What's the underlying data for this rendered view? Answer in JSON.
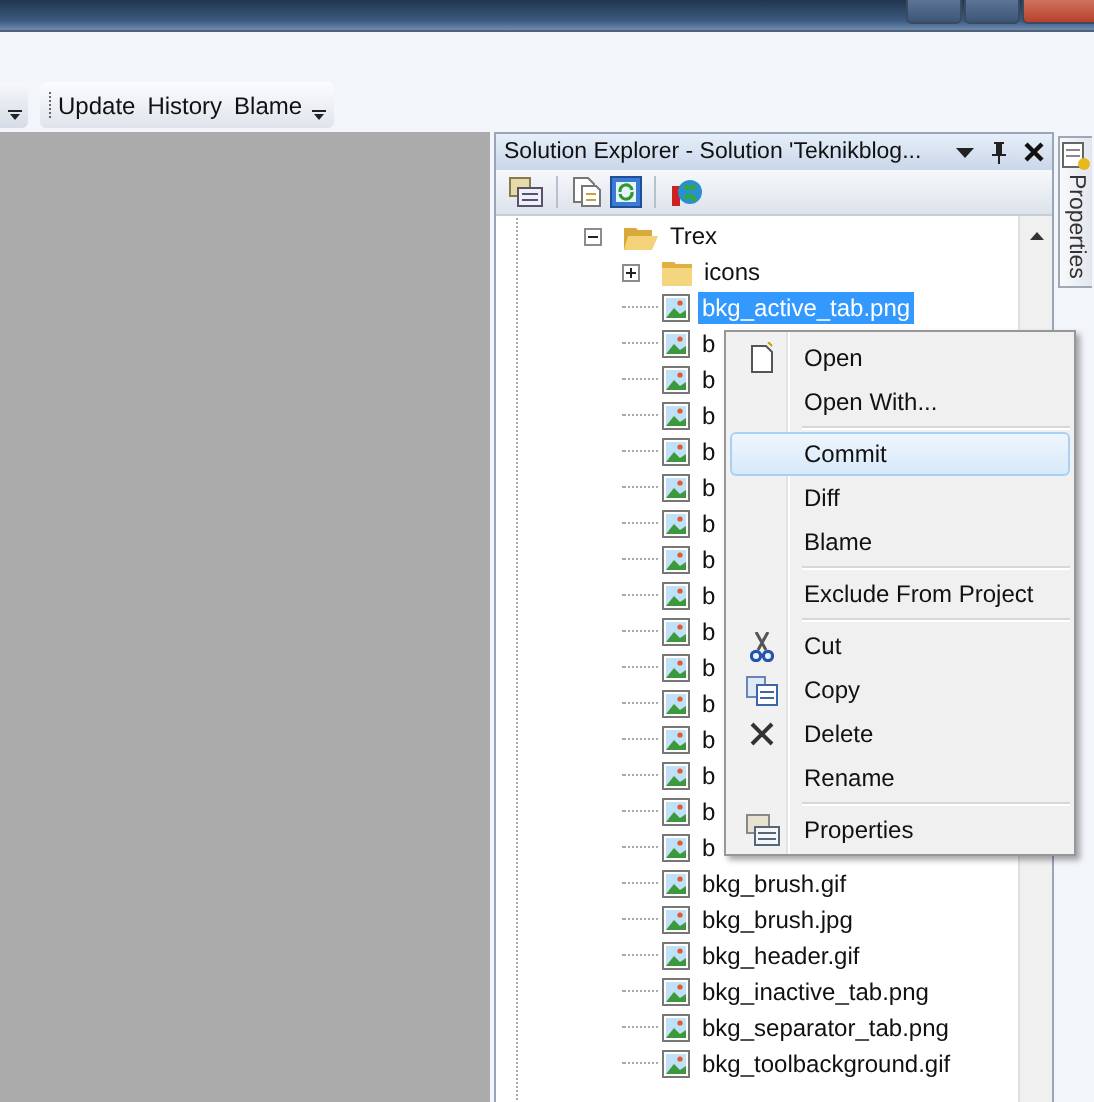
{
  "toolbar": {
    "buttons": [
      "Update",
      "History",
      "Blame"
    ]
  },
  "solution_explorer": {
    "title": "Solution Explorer - Solution 'Teknikblog...",
    "tree": [
      {
        "label": "Trex",
        "kind": "folder",
        "expanded": true,
        "selected": false,
        "children": [
          {
            "label": "icons",
            "kind": "folder",
            "expanded": false,
            "selected": false
          },
          {
            "label": "bkg_active_tab.png",
            "kind": "image",
            "selected": true
          },
          {
            "label": "b",
            "kind": "image",
            "selected": false
          },
          {
            "label": "b",
            "kind": "image",
            "selected": false
          },
          {
            "label": "b",
            "kind": "image",
            "selected": false
          },
          {
            "label": "b",
            "kind": "image",
            "selected": false
          },
          {
            "label": "b",
            "kind": "image",
            "selected": false
          },
          {
            "label": "b",
            "kind": "image",
            "selected": false
          },
          {
            "label": "b",
            "kind": "image",
            "selected": false
          },
          {
            "label": "b",
            "kind": "image",
            "selected": false
          },
          {
            "label": "b",
            "kind": "image",
            "selected": false
          },
          {
            "label": "b",
            "kind": "image",
            "selected": false
          },
          {
            "label": "b",
            "kind": "image",
            "selected": false
          },
          {
            "label": "b",
            "kind": "image",
            "selected": false
          },
          {
            "label": "b",
            "kind": "image",
            "selected": false
          },
          {
            "label": "b",
            "kind": "image",
            "selected": false
          },
          {
            "label": "b",
            "kind": "image",
            "selected": false
          },
          {
            "label": "bkg_brush.gif",
            "kind": "image",
            "selected": false
          },
          {
            "label": "bkg_brush.jpg",
            "kind": "image",
            "selected": false
          },
          {
            "label": "bkg_header.gif",
            "kind": "image",
            "selected": false
          },
          {
            "label": "bkg_inactive_tab.png",
            "kind": "image",
            "selected": false
          },
          {
            "label": "bkg_separator_tab.png",
            "kind": "image",
            "selected": false
          },
          {
            "label": "bkg_toolbackground.gif",
            "kind": "image",
            "selected": false
          }
        ]
      }
    ]
  },
  "context_menu": {
    "items": [
      {
        "label": "Open",
        "selected": false,
        "separator_before": false
      },
      {
        "label": "Open With...",
        "selected": false,
        "separator_before": false
      },
      {
        "label": "Commit",
        "selected": true,
        "separator_before": true
      },
      {
        "label": "Diff",
        "selected": false,
        "separator_before": false
      },
      {
        "label": "Blame",
        "selected": false,
        "separator_before": false
      },
      {
        "label": "Exclude From Project",
        "selected": false,
        "separator_before": true
      },
      {
        "label": "Cut",
        "selected": false,
        "separator_before": true
      },
      {
        "label": "Copy",
        "selected": false,
        "separator_before": false
      },
      {
        "label": "Delete",
        "selected": false,
        "separator_before": false
      },
      {
        "label": "Rename",
        "selected": false,
        "separator_before": false
      },
      {
        "label": "Properties",
        "selected": false,
        "separator_before": true
      }
    ]
  },
  "side_tab": {
    "label": "Properties"
  }
}
